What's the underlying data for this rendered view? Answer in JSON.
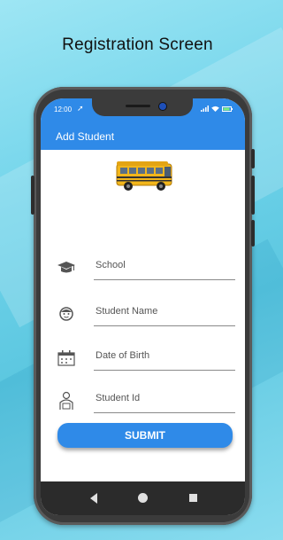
{
  "headline": "Registration Screen",
  "status": {
    "time": "12:00",
    "location_glyph": "➚"
  },
  "appbar": {
    "title": "Add Student"
  },
  "form": {
    "fields": [
      {
        "label": "School",
        "icon": "graduation-cap-icon"
      },
      {
        "label": "Student Name",
        "icon": "face-icon"
      },
      {
        "label": "Date of Birth",
        "icon": "calendar-icon"
      },
      {
        "label": "Student Id",
        "icon": "student-id-icon"
      }
    ],
    "submit_label": "SUBMIT"
  },
  "colors": {
    "primary": "#2f8ae8",
    "background": "#6fd3ea",
    "phone_frame": "#3b3b3b"
  }
}
